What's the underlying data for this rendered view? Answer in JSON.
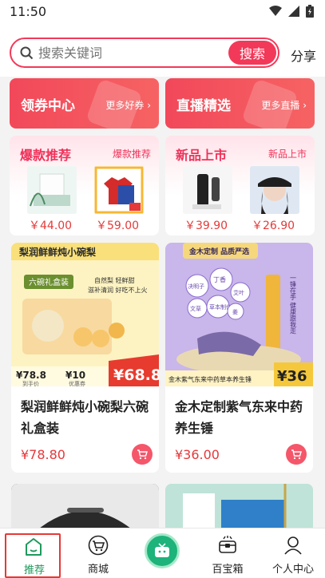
{
  "status_bar": {
    "time": "11:50"
  },
  "search": {
    "placeholder": "搜索关键词",
    "button": "搜索",
    "share": "分享"
  },
  "promos": [
    {
      "title": "领券中心",
      "more": "更多好券 ›"
    },
    {
      "title": "直播精选",
      "more": "更多直播 ›"
    }
  ],
  "panels": [
    {
      "title": "爆款推荐",
      "subtitle": "爆款推荐",
      "prices": [
        "￥44.00",
        "￥59.00"
      ]
    },
    {
      "title": "新品上市",
      "subtitle": "新品上市",
      "prices": [
        "￥39.90",
        "￥26.90"
      ]
    }
  ],
  "cards": [
    {
      "title": "梨润鲜鲜炖小碗梨六碗礼盒装",
      "price": "¥78.80",
      "image": {
        "banner": "梨润鲜鲜炖小碗梨",
        "box": "六碗礼盒装",
        "slogan1": "自然梨 轻鲜甜",
        "slogan2": "滋补清润 好吃不上火",
        "old_price": "¥78.8",
        "coupon": "¥10",
        "sale": "¥68.8",
        "label1": "到手价",
        "label2": "优惠券"
      }
    },
    {
      "title": "金木定制紫气东来中药养生锤",
      "price": "¥36.00",
      "image": {
        "banner": "金木定制 品质严选",
        "tags": [
          "决明子",
          "丁香",
          "艾叶",
          "文草",
          "草本制作",
          "姜"
        ],
        "side": "一锤在手 健康跟我走",
        "bottom": "金木紫气东来中药草本养生锤",
        "price": "¥36"
      }
    }
  ],
  "nav": [
    {
      "label": "推荐",
      "icon": "home-icon"
    },
    {
      "label": "商城",
      "icon": "cart-icon"
    },
    {
      "label": "",
      "icon": "tv-icon"
    },
    {
      "label": "百宝箱",
      "icon": "treasure-box-icon"
    },
    {
      "label": "个人中心",
      "icon": "user-icon"
    }
  ],
  "colors": {
    "accent": "#f2395a",
    "green": "#1db37a",
    "price": "#e5383b"
  }
}
